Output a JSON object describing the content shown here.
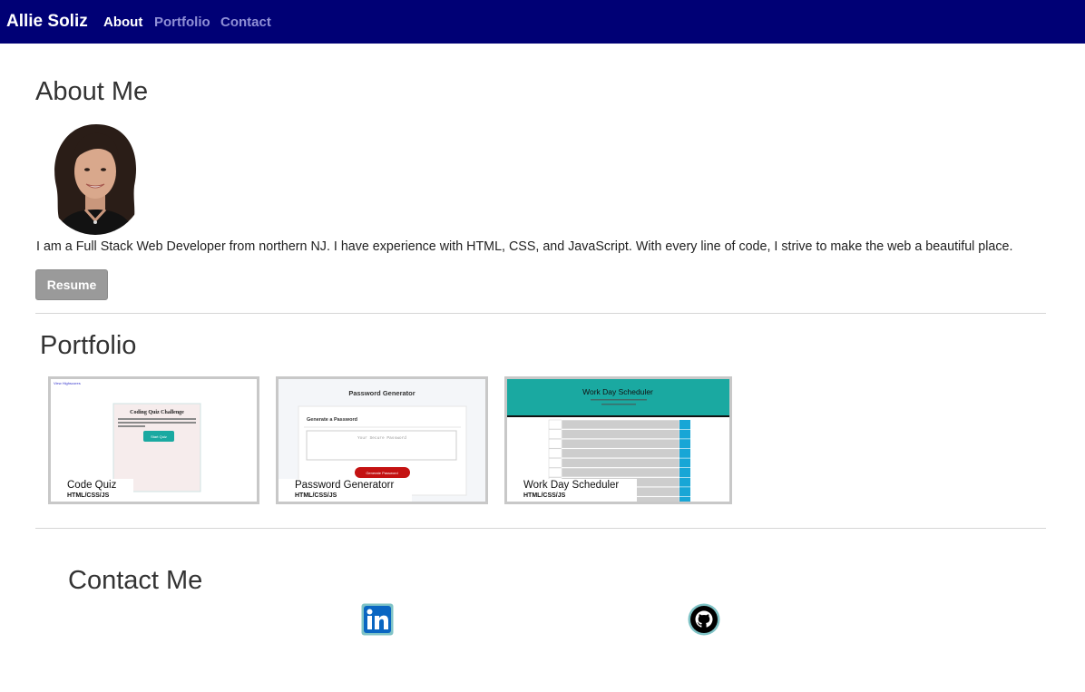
{
  "nav": {
    "brand": "Allie Soliz",
    "links": [
      {
        "label": "About",
        "active": true
      },
      {
        "label": "Portfolio",
        "active": false
      },
      {
        "label": "Contact",
        "active": false
      }
    ]
  },
  "about": {
    "heading": "About Me",
    "bio": "I am a Full Stack Web Developer from northern NJ. I have experience with HTML, CSS, and JavaScript. With every line of code, I strive to make the web a beautiful place.",
    "resume_label": "Resume"
  },
  "portfolio": {
    "heading": "Portfolio",
    "projects": [
      {
        "title": "Code Quiz",
        "tech": "HTML/CSS/JS",
        "preview": {
          "link": "View Highscores",
          "heading": "Coding Quiz Challenge",
          "button": "Start Quiz"
        }
      },
      {
        "title": "Password Generatorr",
        "tech": "HTML/CSS/JS",
        "preview": {
          "heading": "Password Generator",
          "subheading": "Generate a Password",
          "placeholder": "Your Secure Password",
          "button": "Generate Password"
        }
      },
      {
        "title": "Work Day Scheduler",
        "tech": "HTML/CSS/JS",
        "preview": {
          "heading": "Work Day Scheduler"
        }
      }
    ]
  },
  "contact": {
    "heading": "Contact Me",
    "icons": [
      "linkedin-icon",
      "github-icon"
    ]
  },
  "colors": {
    "navbar": "#000075",
    "nav_inactive": "#8f8fd6",
    "button": "#9a9a9a",
    "card_border": "#c8c8c8",
    "scheduler_teal": "#1aa9a1",
    "linkedin_blue": "#0a66c2"
  }
}
